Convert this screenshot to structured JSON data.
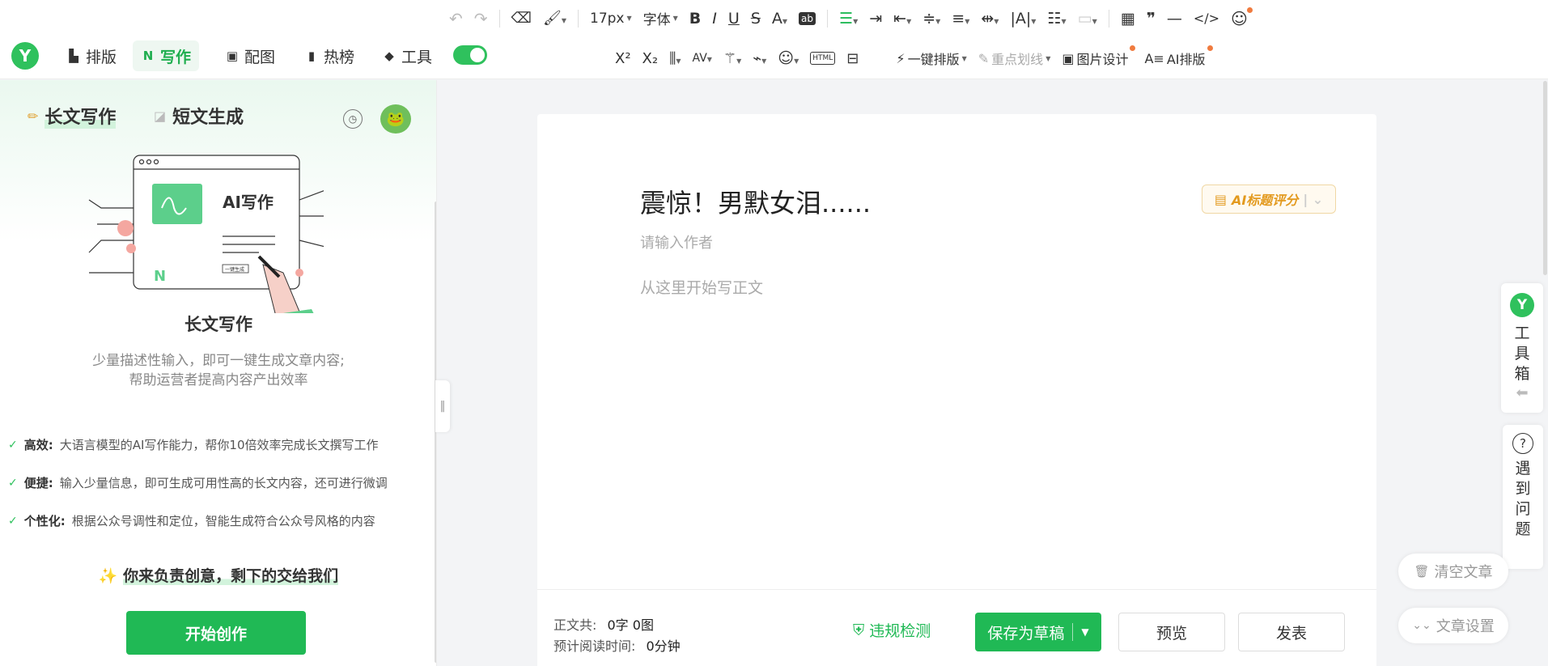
{
  "toolbar_top": {
    "font_size": "17px",
    "font_family": "字体",
    "ab_label": "ab"
  },
  "toolbar_bottom": {
    "one_click_layout": "一键排版",
    "highlight_line": "重点划线",
    "image_design": "图片设计",
    "ai_layout": "AI排版",
    "superscript": "X²",
    "subscript": "X₂"
  },
  "nav": {
    "logo": "Y",
    "items": [
      {
        "label": "排版",
        "icon": "layout-icon"
      },
      {
        "label": "写作",
        "icon": "ai-write-icon"
      },
      {
        "label": "配图",
        "icon": "image-icon"
      },
      {
        "label": "热榜",
        "icon": "bookmark-icon"
      },
      {
        "label": "工具",
        "icon": "cube-icon"
      }
    ]
  },
  "left_panel": {
    "tabs": [
      "长文写作",
      "短文生成"
    ],
    "illus_title": "AI写作",
    "illus_btn": "一键生成",
    "feature_title": "长文写作",
    "feature_desc_1": "少量描述性输入，即可一键生成文章内容;",
    "feature_desc_2": "帮助运营者提高内容产出效率",
    "features": [
      {
        "name": "高效:",
        "desc": "大语言模型的AI写作能力，帮你10倍效率完成长文撰写工作"
      },
      {
        "name": "便捷:",
        "desc": "输入少量信息，即可生成可用性高的长文内容，还可进行微调"
      },
      {
        "name": "个性化:",
        "desc": "根据公众号调性和定位，智能生成符合公众号风格的内容"
      }
    ],
    "slogan": "你来负责创意，剩下的交给我们",
    "start_button": "开始创作"
  },
  "editor": {
    "title": "震惊！男默女泪......",
    "author_placeholder": "请输入作者",
    "body_placeholder": "从这里开始写正文",
    "ai_score_button": "AI标题评分"
  },
  "footer": {
    "word_count_label": "正文共:",
    "word_count_value": "0字 0图",
    "read_time_label": "预计阅读时间:",
    "read_time_value": "0分钟",
    "compliance_check": "违规检测",
    "save_draft": "保存为草稿",
    "preview": "预览",
    "publish": "发表"
  },
  "right_side": {
    "toolbox_logo": "Y",
    "toolbox_label": [
      "工",
      "具",
      "箱"
    ],
    "help_label": [
      "遇",
      "到",
      "问",
      "题"
    ],
    "clear_article": "清空文章",
    "article_settings": "文章设置"
  },
  "colors": {
    "brand_green": "#20b955",
    "accent_orange": "#e39a1f"
  }
}
